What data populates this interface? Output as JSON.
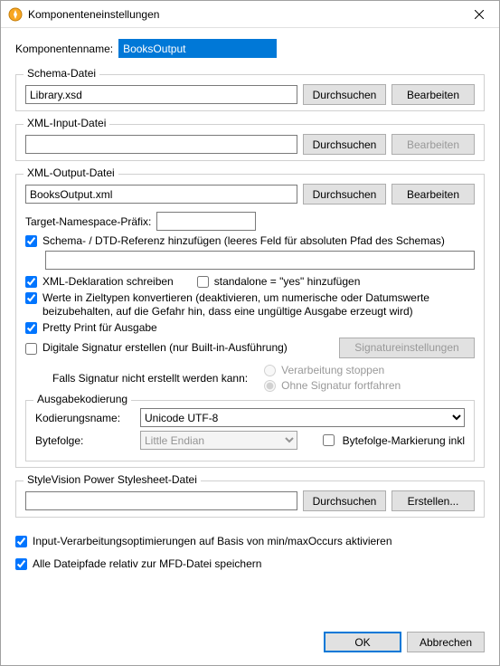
{
  "title": "Komponenteneinstellungen",
  "componentName": {
    "label": "Komponentenname:",
    "value": "BooksOutput"
  },
  "schemaFile": {
    "legend": "Schema-Datei",
    "value": "Library.xsd",
    "browse": "Durchsuchen",
    "edit": "Bearbeiten"
  },
  "xmlInput": {
    "legend": "XML-Input-Datei",
    "value": "",
    "browse": "Durchsuchen",
    "edit": "Bearbeiten"
  },
  "xmlOutput": {
    "legend": "XML-Output-Datei",
    "value": "BooksOutput.xml",
    "browse": "Durchsuchen",
    "edit": "Bearbeiten",
    "targetNsLabel": "Target-Namespace-Präfix:",
    "targetNsValue": "",
    "addSchemaRef": "Schema- / DTD-Referenz hinzufügen (leeres Feld für absoluten Pfad des Schemas)",
    "schemaRefPath": "",
    "writeXmlDecl": "XML-Deklaration schreiben",
    "standalone": "standalone = \"yes\" hinzufügen",
    "convertValues": "Werte in Zieltypen konvertieren (deaktivieren, um numerische oder Datumswerte beizubehalten, auf die Gefahr hin, dass eine ungültige Ausgabe erzeugt wird)",
    "prettyPrint": "Pretty Print für Ausgabe",
    "digitalSig": "Digitale Signatur erstellen (nur Built-in-Ausführung)",
    "sigSettings": "Signatureinstellungen",
    "sigFallbackLabel": "Falls Signatur nicht erstellt werden kann:",
    "sigStop": "Verarbeitung stoppen",
    "sigContinue": "Ohne Signatur fortfahren",
    "encoding": {
      "legend": "Ausgabekodierung",
      "nameLabel": "Kodierungsname:",
      "nameValue": "Unicode UTF-8",
      "byteOrderLabel": "Bytefolge:",
      "byteOrderValue": "Little Endian",
      "bomLabel": "Bytefolge-Markierung inkl"
    }
  },
  "styleVision": {
    "legend": "StyleVision Power Stylesheet-Datei",
    "value": "",
    "browse": "Durchsuchen",
    "create": "Erstellen..."
  },
  "footerOpts": {
    "optimize": "Input-Verarbeitungsoptimierungen auf Basis von min/maxOccurs aktivieren",
    "relativePaths": "Alle Dateipfade relativ zur MFD-Datei speichern"
  },
  "buttons": {
    "ok": "OK",
    "cancel": "Abbrechen"
  }
}
